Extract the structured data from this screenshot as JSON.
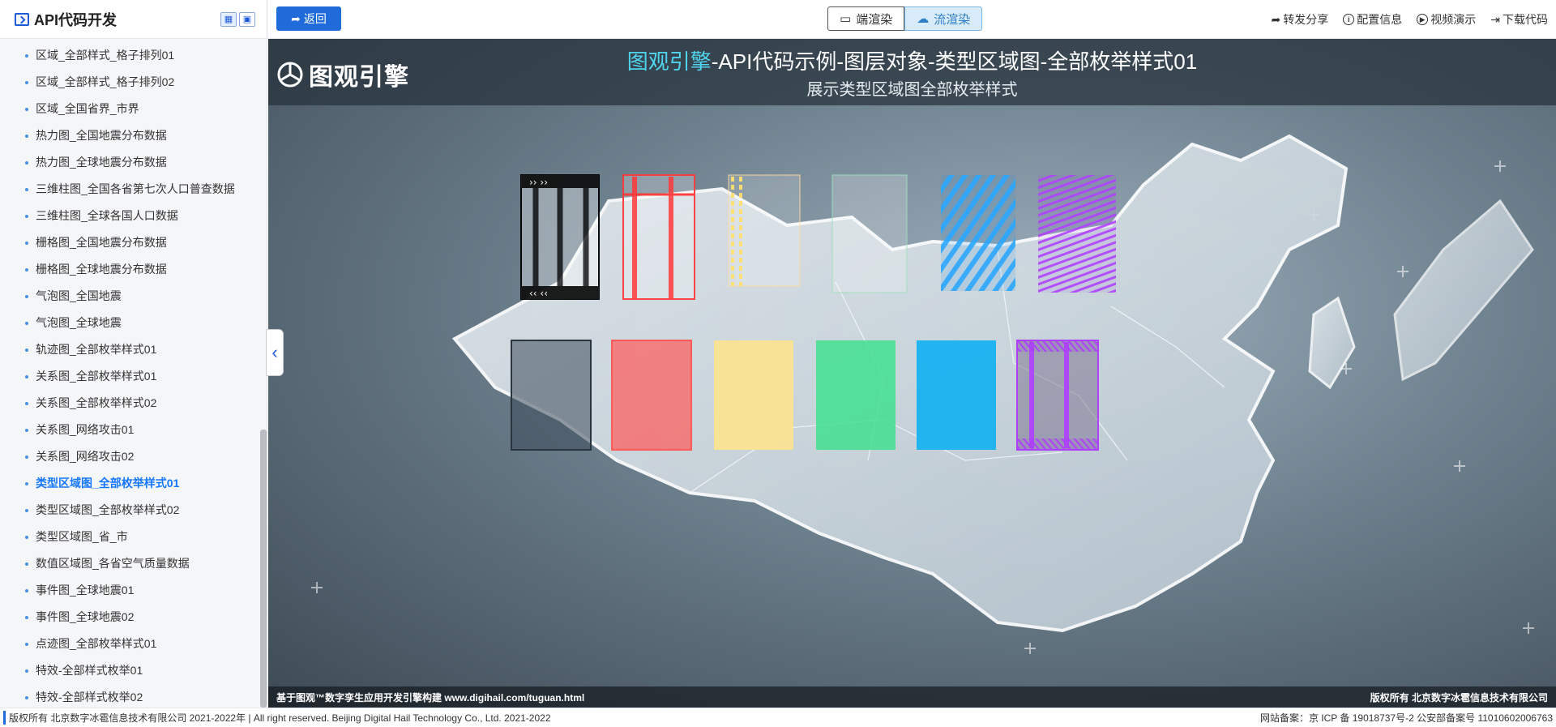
{
  "sidebar": {
    "title": "API代码开发",
    "items": [
      {
        "label": "区域_全部样式_格子排列01"
      },
      {
        "label": "区域_全部样式_格子排列02"
      },
      {
        "label": "区域_全国省界_市界"
      },
      {
        "label": "热力图_全国地震分布数据"
      },
      {
        "label": "热力图_全球地震分布数据"
      },
      {
        "label": "三维柱图_全国各省第七次人口普查数据"
      },
      {
        "label": "三维柱图_全球各国人口数据"
      },
      {
        "label": "栅格图_全国地震分布数据"
      },
      {
        "label": "栅格图_全球地震分布数据"
      },
      {
        "label": "气泡图_全国地震"
      },
      {
        "label": "气泡图_全球地震"
      },
      {
        "label": "轨迹图_全部枚举样式01"
      },
      {
        "label": "关系图_全部枚举样式01"
      },
      {
        "label": "关系图_全部枚举样式02"
      },
      {
        "label": "关系图_网络攻击01"
      },
      {
        "label": "关系图_网络攻击02"
      },
      {
        "label": "类型区域图_全部枚举样式01"
      },
      {
        "label": "类型区域图_全部枚举样式02"
      },
      {
        "label": "类型区域图_省_市"
      },
      {
        "label": "数值区域图_各省空气质量数据"
      },
      {
        "label": "事件图_全球地震01"
      },
      {
        "label": "事件图_全球地震02"
      },
      {
        "label": "点迹图_全部枚举样式01"
      },
      {
        "label": "特效-全部样式枚举01"
      },
      {
        "label": "特效-全部样式枚举02"
      }
    ],
    "active_index": 16
  },
  "topbar": {
    "back_label": "返回",
    "render_device_label": "端渲染",
    "render_stream_label": "流渲染",
    "share_label": "转发分享",
    "config_label": "配置信息",
    "video_label": "视频演示",
    "download_label": "下载代码"
  },
  "viewer": {
    "logo_text": "图观引擎",
    "title_highlight": "图观引擎",
    "title_rest": "-API代码示例-图层对象-类型区域图-全部枚举样式01",
    "subtitle": "展示类型区域图全部枚举样式",
    "footer_left": "基于图观™数字孪生应用开发引擎构建 www.digihail.com/tuguan.html",
    "footer_right": "版权所有 北京数字冰雹信息技术有限公司"
  },
  "footer": {
    "left": "版权所有 北京数字冰雹信息技术有限公司 2021-2022年 | All right reserved. Beijing Digital Hail Technology Co., Ltd. 2021-2022",
    "right": "网站备案：京 ICP 备 19018737号-2 公安部备案号 11010602006763"
  },
  "colors": {
    "accent": "#1e6bd9",
    "title_highlight": "#4fd6ef",
    "row2_fills": [
      "#4a5560",
      "#ff5a5a",
      "#ffe48a",
      "#3fe08e",
      "#18b2f0",
      "#8a4ad8"
    ],
    "row1_strokes": [
      "#000000",
      "#ff3a3a",
      "#ffe070",
      "#9fe0c0",
      "#1ea0ff",
      "#b040ff"
    ]
  }
}
